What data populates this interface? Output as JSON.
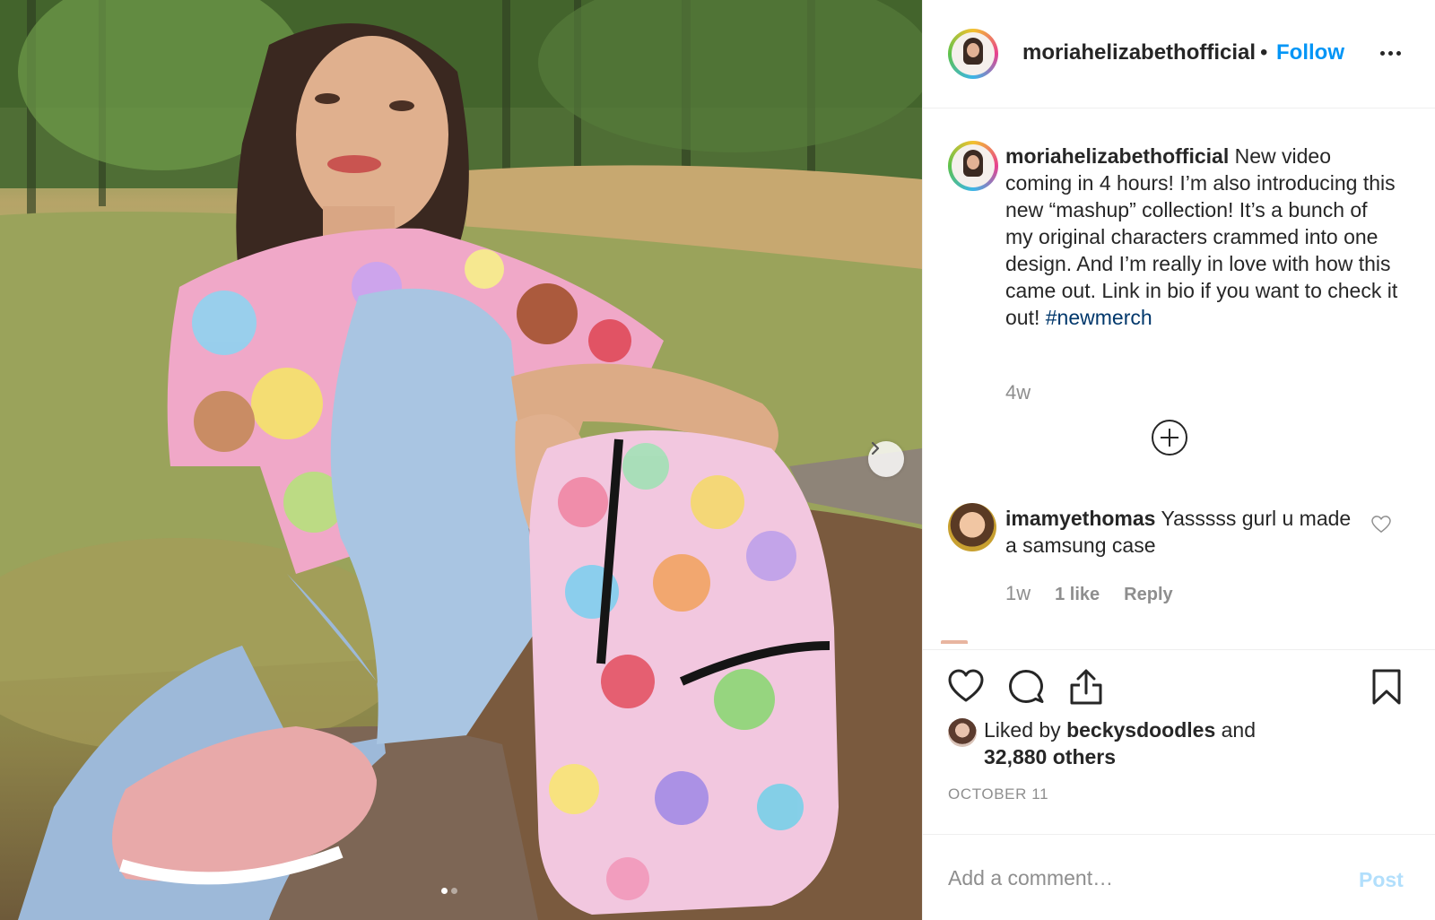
{
  "post": {
    "username": "moriahelizabethofficial",
    "separator": "•",
    "follow_label": "Follow",
    "more_options_icon": "more-horizontal-icon"
  },
  "caption": {
    "username": "moriahelizabethofficial",
    "text": " New video coming in 4 hours! I’m also introducing this new “mashup” collection! It’s a bunch of my original characters crammed into one design. And I’m really in love with how this came out. Link in bio if you want to check it out! ",
    "hashtag": "#newmerch",
    "time": "4w",
    "load_more_icon": "plus-circle-icon"
  },
  "comments": [
    {
      "username": "imamyethomas",
      "text": " Yasssss gurl u made a samsung case",
      "time": "1w",
      "likes": "1 like",
      "reply_label": "Reply"
    }
  ],
  "actions": {
    "like_icon": "heart-icon",
    "comment_icon": "speech-bubble-icon",
    "share_icon": "share-icon",
    "save_icon": "bookmark-icon"
  },
  "likes": {
    "prefix": "Liked by ",
    "user": "beckysdoodles",
    "middle": " and",
    "others": "32,880 others"
  },
  "date": "OCTOBER 11",
  "add_comment": {
    "placeholder": "Add a comment…",
    "post_label": "Post"
  },
  "carousel": {
    "slide_count": 2,
    "active_slide": 1,
    "next_icon": "chevron-right-icon"
  },
  "colors": {
    "accent_blue": "#0095f6",
    "hashtag": "#00376b",
    "muted": "#8e8e8e",
    "post_disabled": "#b2dffc"
  }
}
